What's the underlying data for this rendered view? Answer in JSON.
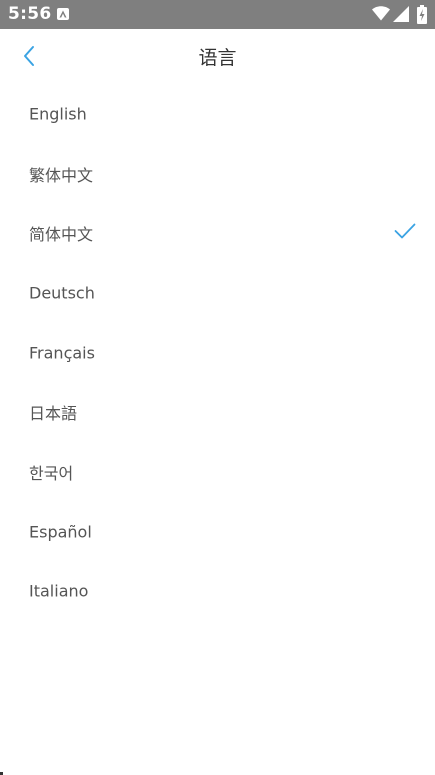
{
  "status_bar": {
    "time": "5:56",
    "icons": [
      "a-notification-icon",
      "wifi-icon",
      "cell-signal-icon",
      "battery-charging-icon"
    ]
  },
  "header": {
    "title": "语言",
    "back_icon": "chevron-left-icon"
  },
  "languages": {
    "items": [
      {
        "label": "English",
        "selected": false
      },
      {
        "label": "繁体中文",
        "selected": false
      },
      {
        "label": "简体中文",
        "selected": true
      },
      {
        "label": "Deutsch",
        "selected": false
      },
      {
        "label": "Français",
        "selected": false
      },
      {
        "label": "日本語",
        "selected": false
      },
      {
        "label": "한국어",
        "selected": false
      },
      {
        "label": "Español",
        "selected": false
      },
      {
        "label": "Italiano",
        "selected": false
      }
    ]
  },
  "colors": {
    "accent": "#3aa3e3",
    "status_bar_bg": "#7f7f7f",
    "text": "#555555",
    "title": "#333333"
  }
}
